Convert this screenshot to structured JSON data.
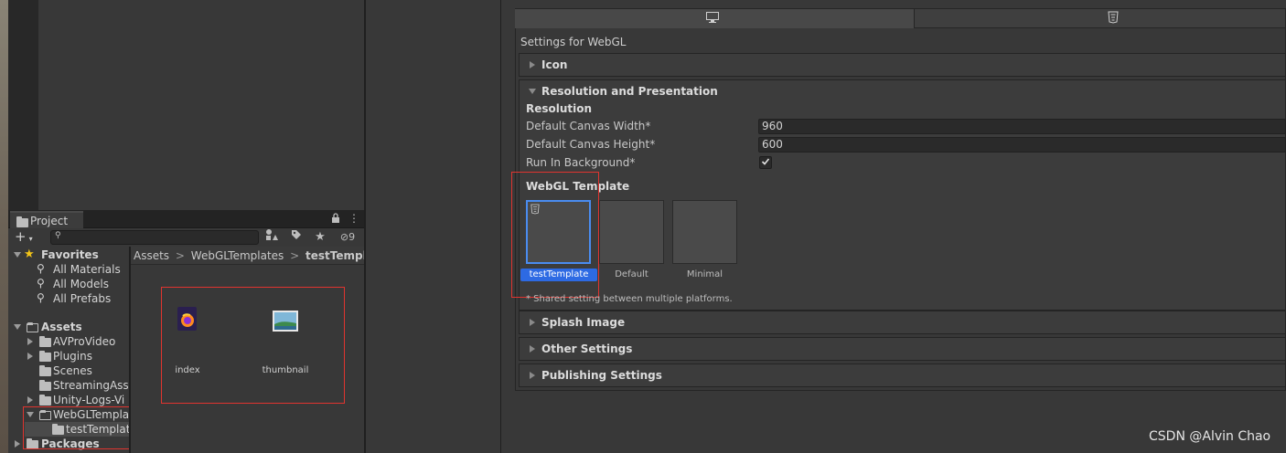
{
  "project": {
    "tab_label": "Project",
    "search_placeholder": "",
    "hidden_count": "9",
    "favorites": {
      "label": "Favorites",
      "items": [
        "All Materials",
        "All Models",
        "All Prefabs"
      ]
    },
    "assets": {
      "label": "Assets",
      "items": [
        "AVProVideo",
        "Plugins",
        "Scenes",
        "StreamingAsse",
        "Unity-Logs-Vi",
        "WebGLTempla",
        "testTemplat"
      ]
    },
    "packages_label": "Packages",
    "breadcrumb": [
      "Assets",
      "WebGLTemplates",
      "testTemplate"
    ],
    "files": [
      {
        "name": "index",
        "icon": "firefox-html-icon"
      },
      {
        "name": "thumbnail",
        "icon": "image-icon"
      }
    ]
  },
  "player_settings": {
    "platform_tabs": [
      {
        "icon": "desktop-icon"
      },
      {
        "icon": "html5-icon"
      }
    ],
    "settings_for": "Settings for WebGL",
    "sections": {
      "icon": "Icon",
      "resolution_presentation": "Resolution and Presentation",
      "splash_image": "Splash Image",
      "other_settings": "Other Settings",
      "publishing_settings": "Publishing Settings"
    },
    "resolution": {
      "heading": "Resolution",
      "canvas_width_label": "Default Canvas Width*",
      "canvas_width_value": "960",
      "canvas_height_label": "Default Canvas Height*",
      "canvas_height_value": "600",
      "run_in_background_label": "Run In Background*",
      "run_in_background_checked": true
    },
    "webgl_template": {
      "heading": "WebGL Template",
      "templates": [
        "testTemplate",
        "Default",
        "Minimal"
      ],
      "selected": "testTemplate"
    },
    "shared_note": "* Shared setting between multiple platforms."
  },
  "watermark": "CSDN @Alvin Chao",
  "colors": {
    "accent_selected": "#2d6ae3",
    "annotation_red": "#e0342f",
    "favorites_star": "#f2c418"
  }
}
